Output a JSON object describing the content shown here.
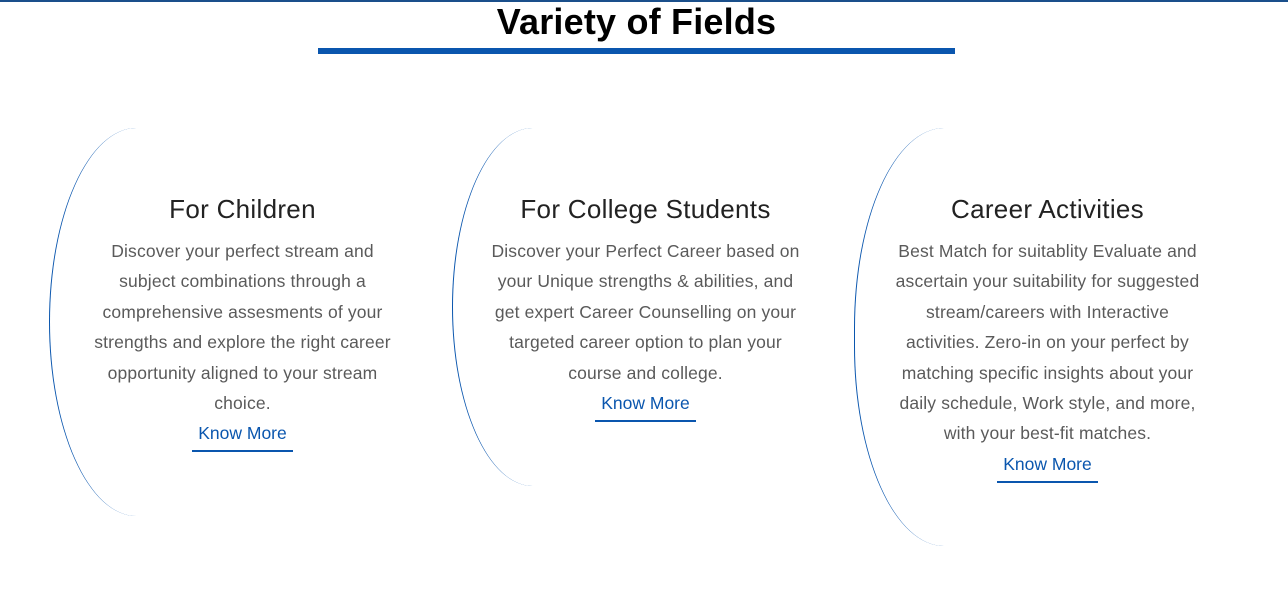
{
  "section": {
    "title": "Variety of Fields"
  },
  "colors": {
    "accent": "#0a56ae",
    "title": "#000000",
    "body_text": "#5a5a5a",
    "card_title": "#222222"
  },
  "cards": [
    {
      "title": "For Children",
      "text_lines": [
        "Discover your perfect stream and",
        "subject combinations through a",
        "comprehensive assesments of your",
        "strengths and explore the right career",
        "opportunity aligned to your stream",
        "choice."
      ],
      "link_label": "Know More"
    },
    {
      "title": "For College Students",
      "text_lines": [
        "Discover your Perfect Career based on",
        "your Unique strengths & abilities, and",
        "get expert Career Counselling on your",
        "targeted career option to plan your",
        "course and college."
      ],
      "link_label": "Know More"
    },
    {
      "title": "Career Activities",
      "text_lines": [
        "Best Match for suitablity Evaluate and",
        "ascertain your suitability for suggested",
        "stream/careers with Interactive",
        "activities. Zero-in on your perfect by",
        "matching specific insights about your",
        "daily schedule, Work style, and more,",
        "with your best-fit matches."
      ],
      "link_label": "Know More"
    }
  ]
}
